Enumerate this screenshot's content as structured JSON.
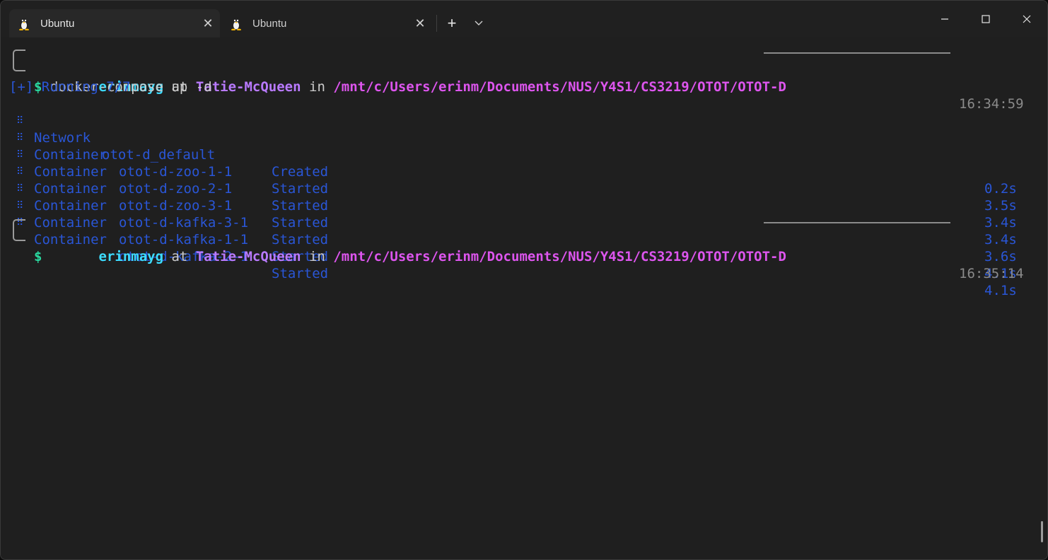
{
  "tabs": [
    {
      "label": "Ubuntu",
      "icon": "tux-icon",
      "active": true
    },
    {
      "label": "Ubuntu",
      "icon": "tux-icon",
      "active": false
    }
  ],
  "new_tab_label": "+",
  "colors": {
    "user": "#3ddcff",
    "host": "#b97aff",
    "path": "#dd55ee",
    "prompt": "#29d89f",
    "compose_output": "#2a56d6",
    "timestamp": "#8a8a8a"
  },
  "prompt1": {
    "user": "erinmayg",
    "at": "at",
    "host": "Tatie-McQueen",
    "in": "in",
    "path": "/mnt/c/Users/erinm/Documents/NUS/Y4S1/CS3219/OTOT/OTOT-D",
    "time": "16:34:59",
    "symbol": "$",
    "command": "docker-compose up -d"
  },
  "compose": {
    "header": "[+] Running 7/7",
    "rows": [
      {
        "kind": "Network",
        "name": "otot-d_default",
        "status": "Created",
        "time": "0.2s"
      },
      {
        "kind": "Container",
        "name": "otot-d-zoo-1-1",
        "status": "Started",
        "time": "3.5s"
      },
      {
        "kind": "Container",
        "name": "otot-d-zoo-2-1",
        "status": "Started",
        "time": "3.4s"
      },
      {
        "kind": "Container",
        "name": "otot-d-zoo-3-1",
        "status": "Started",
        "time": "3.4s"
      },
      {
        "kind": "Container",
        "name": "otot-d-kafka-3-1",
        "status": "Started",
        "time": "3.6s"
      },
      {
        "kind": "Container",
        "name": "otot-d-kafka-1-1",
        "status": "Started",
        "time": "4.1s"
      },
      {
        "kind": "Container",
        "name": "otot-d-kafka-2-1",
        "status": "Started",
        "time": "4.1s"
      }
    ]
  },
  "prompt2": {
    "user": "erinmayg",
    "at": "at",
    "host": "Tatie-McQueen",
    "in": "in",
    "path": "/mnt/c/Users/erinm/Documents/NUS/Y4S1/CS3219/OTOT/OTOT-D",
    "time": "16:35:14",
    "symbol": "$"
  }
}
